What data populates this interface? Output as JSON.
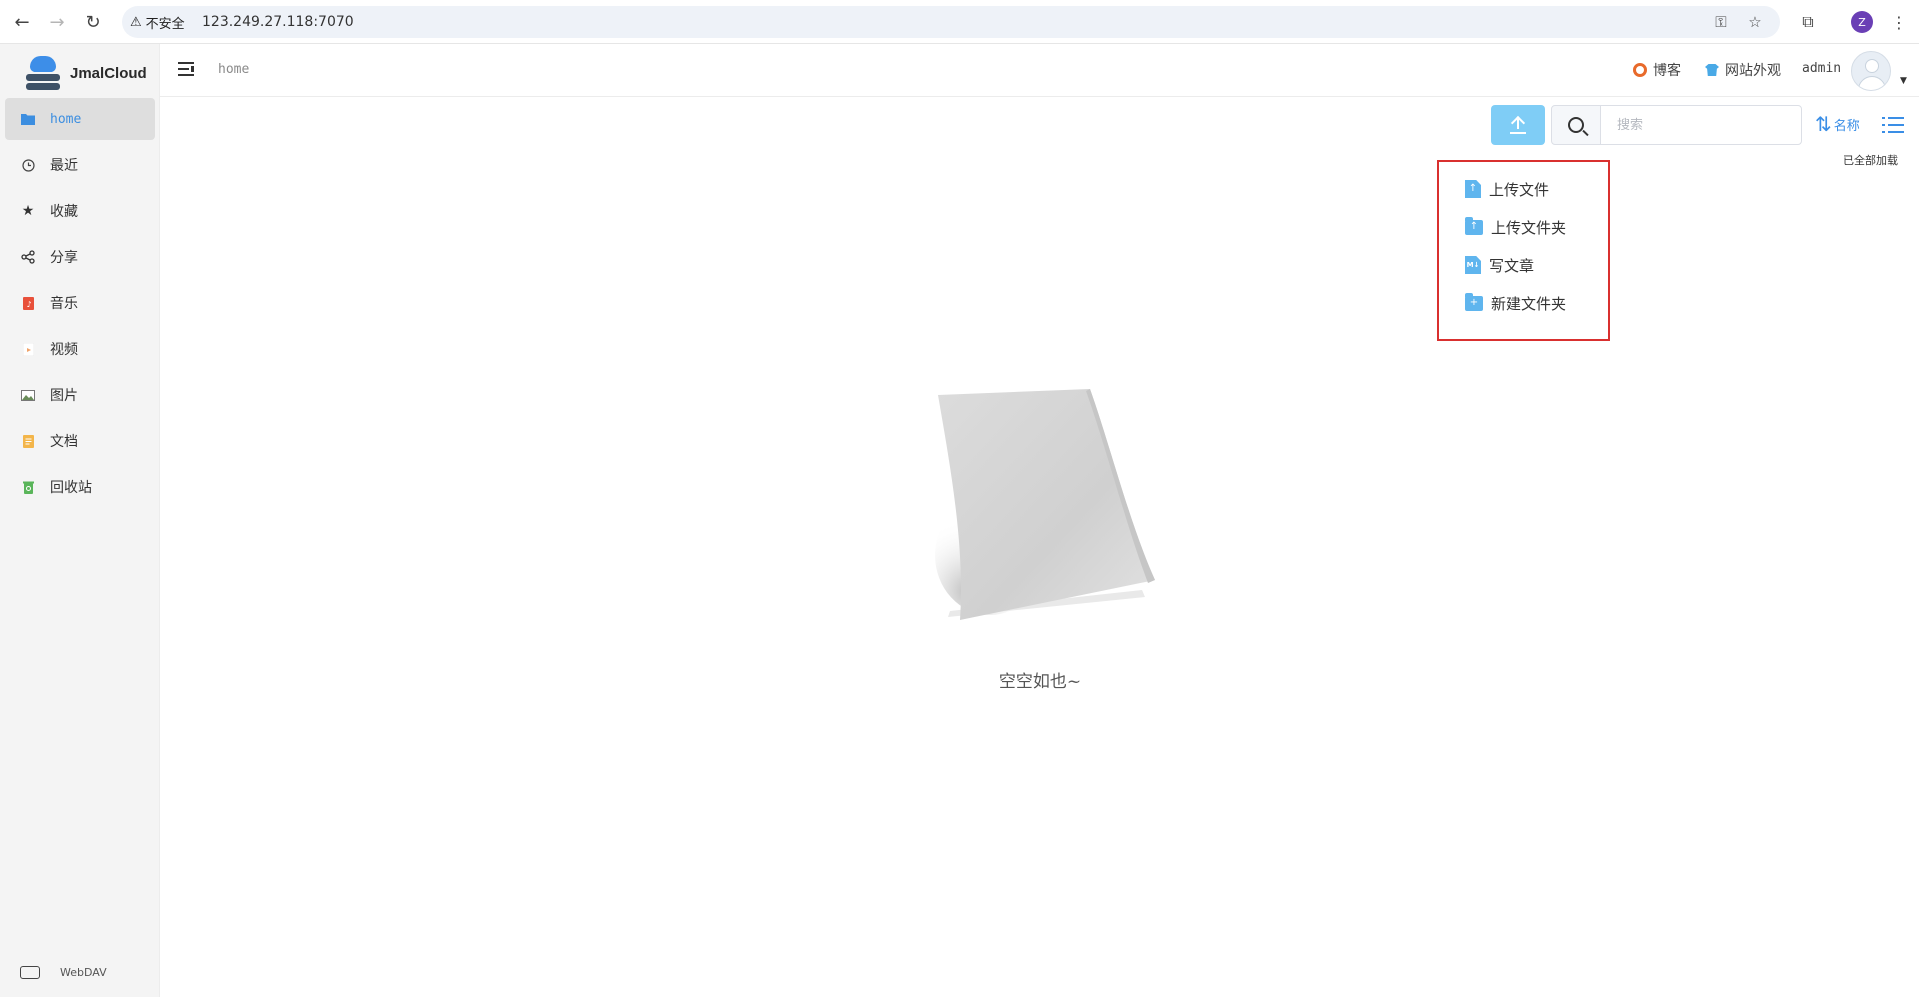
{
  "browser": {
    "security_label": "不安全",
    "url": "123.249.27.118:7070",
    "profile_initial": "Z"
  },
  "app": {
    "name": "JmalCloud"
  },
  "sidebar": {
    "items": [
      {
        "label": "home",
        "icon": "folder-icon",
        "color": "#3c8ee0"
      },
      {
        "label": "最近",
        "icon": "clock-icon",
        "color": "#444444"
      },
      {
        "label": "收藏",
        "icon": "star-icon",
        "color": "#333333"
      },
      {
        "label": "分享",
        "icon": "share-icon",
        "color": "#333333"
      },
      {
        "label": "音乐",
        "icon": "music-icon",
        "color": "#e8503a"
      },
      {
        "label": "视频",
        "icon": "video-icon",
        "color": "#f0a36a"
      },
      {
        "label": "图片",
        "icon": "image-icon",
        "color": "#6a8c5a"
      },
      {
        "label": "文档",
        "icon": "document-icon",
        "color": "#f3b54a"
      },
      {
        "label": "回收站",
        "icon": "recycle-bin-icon",
        "color": "#5ab55a"
      }
    ],
    "webdav_label": "WebDAV"
  },
  "header": {
    "breadcrumb": "home",
    "blog_label": "博客",
    "appearance_label": "网站外观",
    "username": "admin"
  },
  "toolbar": {
    "search_placeholder": "搜索",
    "sort_label": "名称",
    "loaded_status": "已全部加载"
  },
  "upload_menu": {
    "items": [
      {
        "label": "上传文件",
        "icon": "upload-file-icon"
      },
      {
        "label": "上传文件夹",
        "icon": "upload-folder-icon"
      },
      {
        "label": "写文章",
        "icon": "markdown-file-icon"
      },
      {
        "label": "新建文件夹",
        "icon": "new-folder-icon"
      }
    ]
  },
  "empty_state": {
    "message": "空空如也~"
  },
  "colors": {
    "accent": "#3a8ee6",
    "upload_button": "#7fcdf6",
    "highlight_border": "#d9302f"
  }
}
